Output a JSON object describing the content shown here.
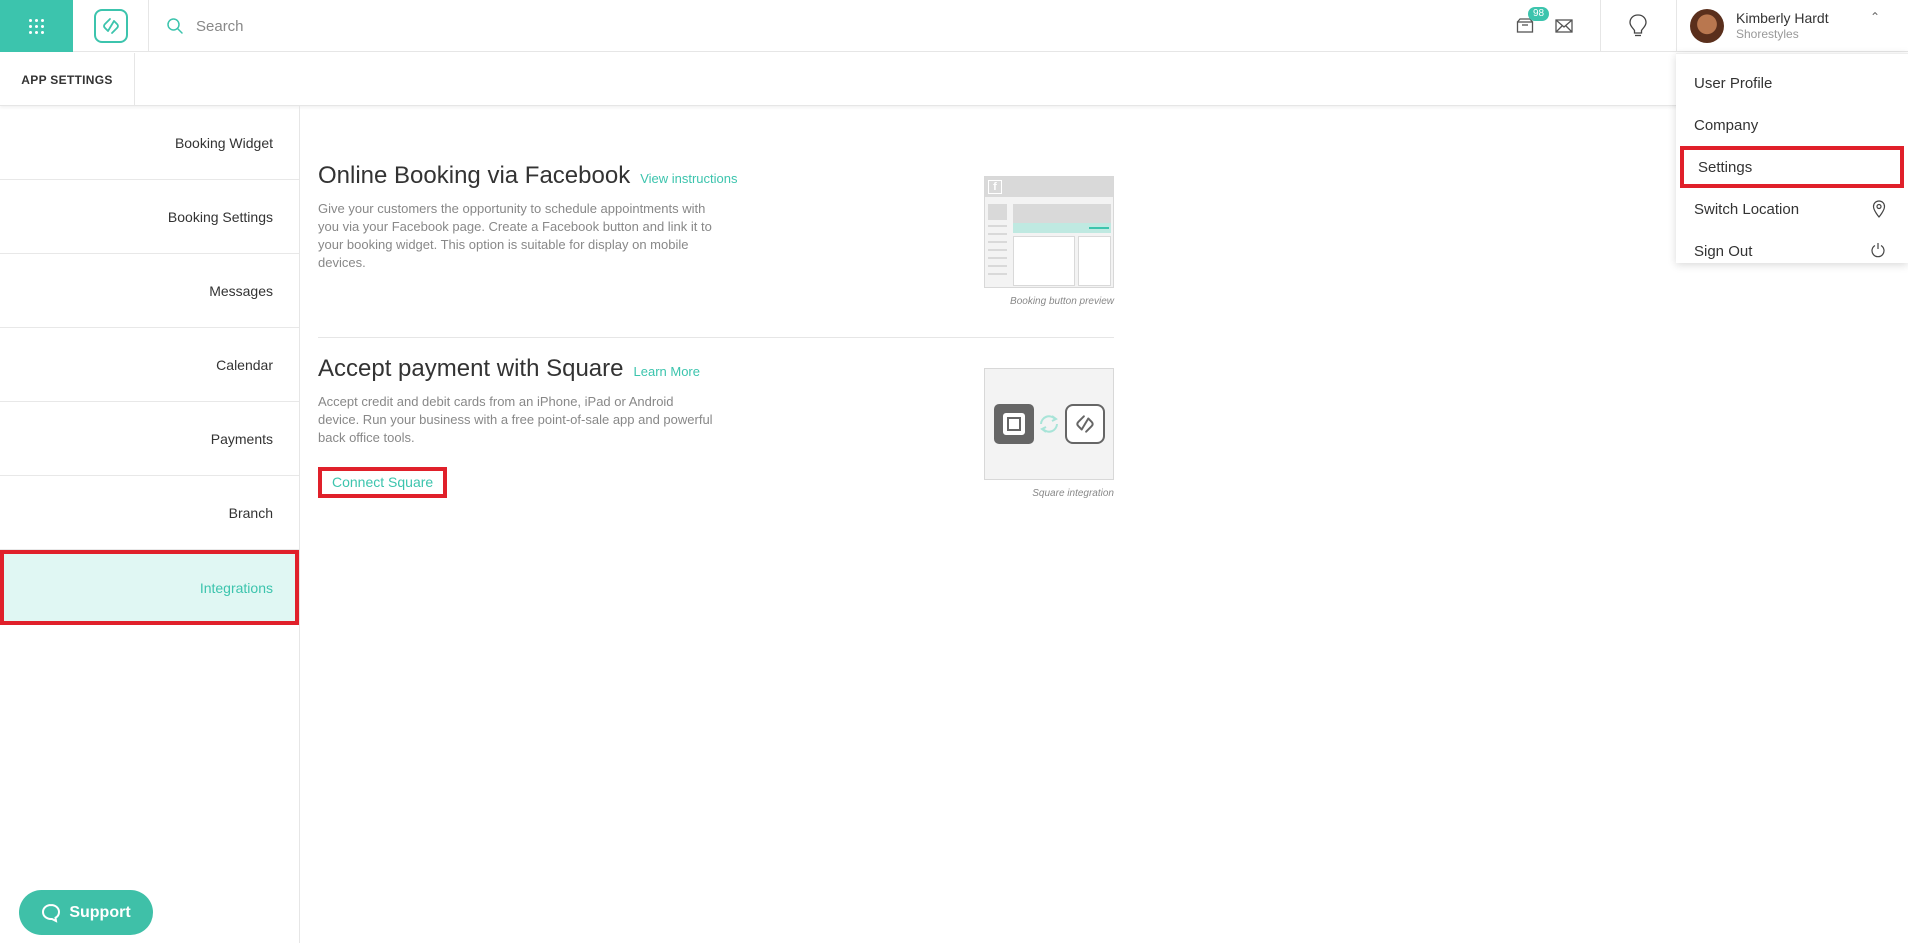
{
  "header": {
    "search_placeholder": "Search",
    "notification_count": "98",
    "user": {
      "name": "Kimberly Hardt",
      "company": "Shorestyles"
    }
  },
  "subbar": {
    "tab_label": "APP SETTINGS"
  },
  "sidebar": {
    "items": [
      {
        "label": "Booking Widget"
      },
      {
        "label": "Booking Settings"
      },
      {
        "label": "Messages"
      },
      {
        "label": "Calendar"
      },
      {
        "label": "Payments"
      },
      {
        "label": "Branch"
      },
      {
        "label": "Integrations",
        "active": true
      }
    ]
  },
  "main": {
    "facebook": {
      "title": "Online Booking via Facebook",
      "link": "View instructions",
      "description": "Give your customers the opportunity to schedule appointments with you via your Facebook page. Create a Facebook button and link it to your booking widget. This option is suitable for display on mobile devices.",
      "preview_caption": "Booking button preview"
    },
    "square": {
      "title": "Accept payment with Square",
      "link": "Learn More",
      "description": "Accept credit and debit cards from an iPhone, iPad or Android device. Run your business with a free point-of-sale app and powerful back office tools.",
      "button": "Connect Square",
      "preview_caption": "Square integration"
    }
  },
  "dropdown": {
    "items": [
      {
        "label": "User Profile"
      },
      {
        "label": "Company"
      },
      {
        "label": "Settings"
      },
      {
        "label": "Switch Location",
        "icon": "location-pin-icon"
      },
      {
        "label": "Sign Out",
        "icon": "power-icon"
      }
    ]
  },
  "support": {
    "label": "Support"
  },
  "colors": {
    "accent": "#3cc4ad",
    "highlight": "#e0202a",
    "active_bg": "#e0f7f3"
  }
}
